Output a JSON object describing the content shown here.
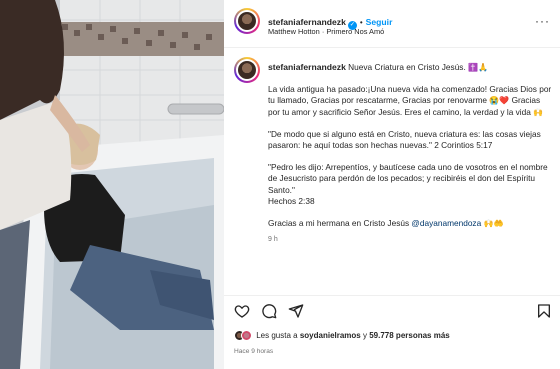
{
  "post": {
    "username": "stefaniafernandezk",
    "follow_label": "Seguir",
    "music": "Matthew Hotton · Primero Nos Amó",
    "caption_title": "Nueva Criatura en Cristo Jesús.",
    "caption_p1": "La vida antigua ha pasado:¡Una nueva vida ha comenzado! Gracias Dios por tu llamado, Gracias por rescatarme, Gracias por renovarme",
    "caption_p1b": "Gracias por tu amor y sacrificio Señor Jesús. Eres el camino, la verdad y la vida",
    "caption_p2": "\"De modo que si alguno está en Cristo, nueva criatura es: las cosas viejas pasaron: he aquí todas son hechas nuevas.\" 2 Corintios 5:17",
    "caption_p3": "\"Pedro les dijo: Arrepentíos, y bautícese cada uno de vosotros en el nombre de Jesucristo para perdón de los pecados; y recibiréis el don del Espíritu Santo.\"",
    "caption_p3_ref": "Hechos 2:38",
    "caption_p4": "Gracias a mi hermana en Cristo Jesús",
    "mention": "@dayanamendoza",
    "caption_time": "9 h",
    "likes_prefix": "Les gusta a",
    "likes_user": "soydanielramos",
    "likes_and": "y",
    "likes_count": "59.778 personas más",
    "posted_ago": "Hace 9 horas"
  },
  "icons": {
    "emoji_cross": "✝️",
    "emoji_pray": "🙏",
    "emoji_cry": "😭",
    "emoji_heart": "❤️",
    "emoji_praise": "🙌",
    "emoji_hands": "🤲"
  },
  "colors": {
    "accent_blue": "#0095f6",
    "mention": "#00376b",
    "muted": "#737373"
  }
}
